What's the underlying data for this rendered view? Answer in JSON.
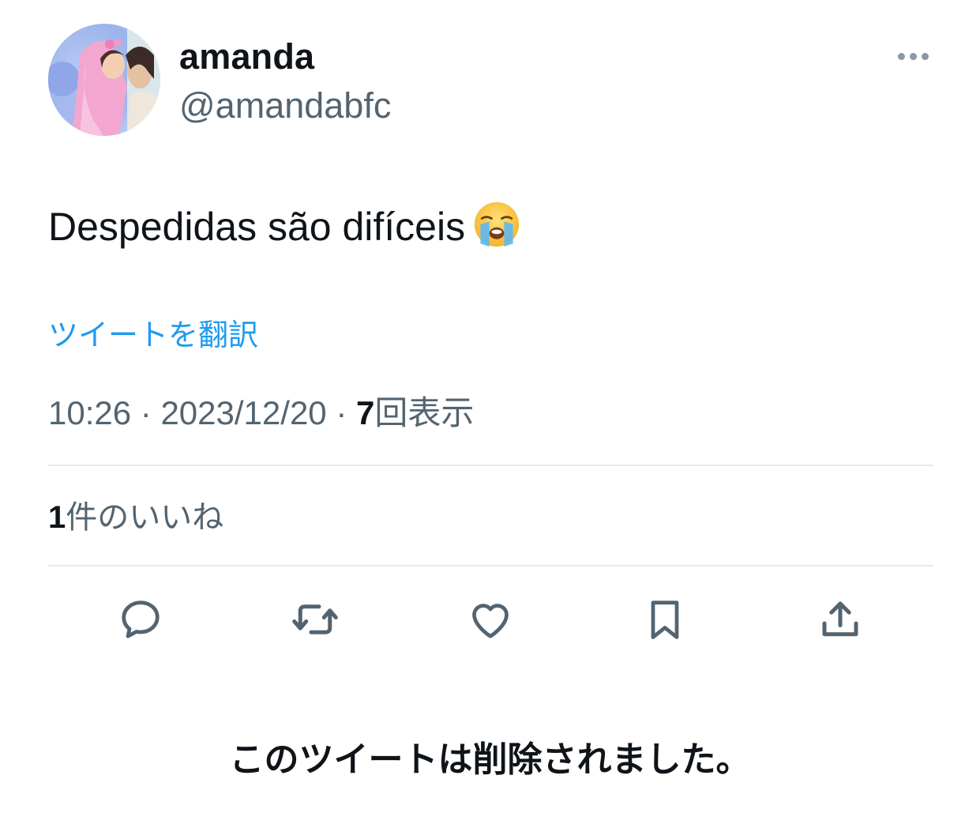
{
  "user": {
    "display_name": "amanda",
    "handle": "@amandabfc",
    "avatar_icon": "profile-photo"
  },
  "more_icon": "more-horizontal-icon",
  "tweet": {
    "text": "Despedidas são difíceis",
    "emoji": "loudly-crying-face",
    "translate_label": "ツイートを翻訳",
    "time": "10:26",
    "separator": "·",
    "date": "2023/12/20",
    "views_count": "7",
    "views_label": "回表示"
  },
  "likes": {
    "count": "1",
    "label": "件のいいね"
  },
  "actions": [
    {
      "name": "reply",
      "icon": "reply-icon"
    },
    {
      "name": "retweet",
      "icon": "retweet-icon"
    },
    {
      "name": "like",
      "icon": "heart-icon"
    },
    {
      "name": "bookmark",
      "icon": "bookmark-icon"
    },
    {
      "name": "share",
      "icon": "share-icon"
    }
  ],
  "deleted_notice": "このツイートは削除されました。",
  "colors": {
    "text_primary": "#0f1419",
    "text_secondary": "#536471",
    "link": "#1d9bf0",
    "divider": "#e6e9ec"
  }
}
